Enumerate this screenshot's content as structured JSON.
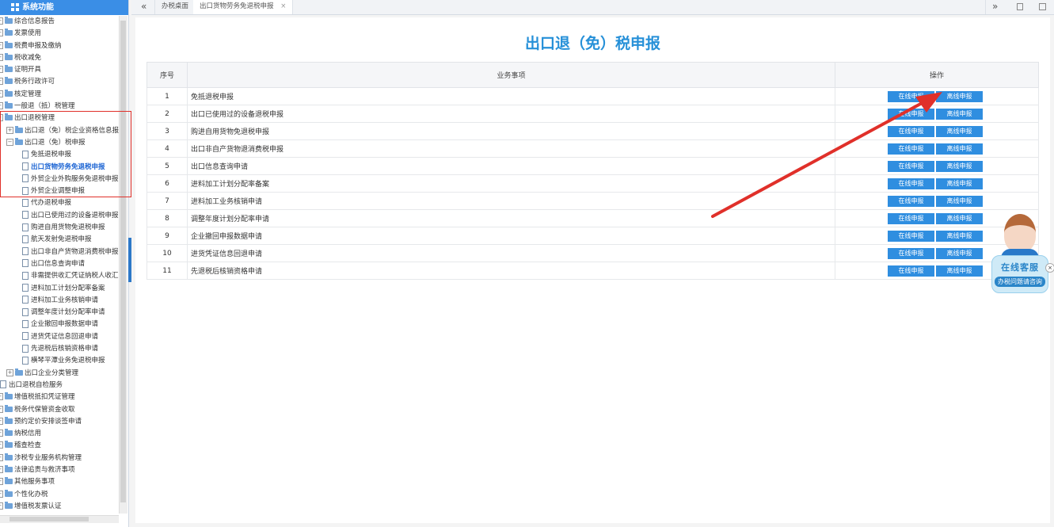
{
  "sidebar": {
    "header": "系统功能",
    "items": [
      {
        "label": "综合信息报告",
        "level": 0,
        "type": "folder",
        "toggle": "-"
      },
      {
        "label": "发票使用",
        "level": 0,
        "type": "folder",
        "toggle": "-"
      },
      {
        "label": "税费申报及缴纳",
        "level": 0,
        "type": "folder",
        "toggle": "-"
      },
      {
        "label": "税收减免",
        "level": 0,
        "type": "folder",
        "toggle": "-"
      },
      {
        "label": "证明开具",
        "level": 0,
        "type": "folder",
        "toggle": "-"
      },
      {
        "label": "税务行政许可",
        "level": 0,
        "type": "folder",
        "toggle": "-"
      },
      {
        "label": "核定管理",
        "level": 0,
        "type": "folder",
        "toggle": "-"
      },
      {
        "label": "一般退（抵）税管理",
        "level": 0,
        "type": "folder",
        "toggle": "-"
      },
      {
        "label": "出口退税管理",
        "level": 0,
        "type": "folder",
        "toggle": "-"
      },
      {
        "label": "出口退（免）税企业资格信息报",
        "level": 1,
        "type": "folder",
        "toggle": "+"
      },
      {
        "label": "出口退（免）税申报",
        "level": 1,
        "type": "folder",
        "toggle": "-"
      },
      {
        "label": "免抵退税申报",
        "level": 2,
        "type": "file"
      },
      {
        "label": "出口货物劳务免退税申报",
        "level": 2,
        "type": "file",
        "selected": true
      },
      {
        "label": "外贸企业外购服务免退税申报",
        "level": 2,
        "type": "file"
      },
      {
        "label": "外贸企业调整申报",
        "level": 2,
        "type": "file"
      },
      {
        "label": "代办退税申报",
        "level": 2,
        "type": "file"
      },
      {
        "label": "出口已使用过的设备退税申报",
        "level": 2,
        "type": "file"
      },
      {
        "label": "购进自用货物免退税申报",
        "level": 2,
        "type": "file"
      },
      {
        "label": "航天发射免退税申报",
        "level": 2,
        "type": "file"
      },
      {
        "label": "出口非自产货物退消费税申报",
        "level": 2,
        "type": "file"
      },
      {
        "label": "出口信息查询申请",
        "level": 2,
        "type": "file"
      },
      {
        "label": "非需提供收汇凭证纳税人收汇",
        "level": 2,
        "type": "file"
      },
      {
        "label": "进料加工计划分配率备案",
        "level": 2,
        "type": "file"
      },
      {
        "label": "进料加工业务核销申请",
        "level": 2,
        "type": "file"
      },
      {
        "label": "调整年度计划分配率申请",
        "level": 2,
        "type": "file"
      },
      {
        "label": "企业撤回申报数据申请",
        "level": 2,
        "type": "file"
      },
      {
        "label": "进货凭证信息回退申请",
        "level": 2,
        "type": "file"
      },
      {
        "label": "先退税后核销资格申请",
        "level": 2,
        "type": "file"
      },
      {
        "label": "横琴平潭业务免退税申报",
        "level": 2,
        "type": "file"
      },
      {
        "label": "出口企业分类管理",
        "level": 1,
        "type": "folder",
        "toggle": "+"
      },
      {
        "label": "出口退税自检服务",
        "level": 0,
        "type": "file"
      },
      {
        "label": "增值税抵扣凭证管理",
        "level": 0,
        "type": "folder",
        "toggle": "-"
      },
      {
        "label": "税务代保管资金收取",
        "level": 0,
        "type": "folder",
        "toggle": "-"
      },
      {
        "label": "预约定价安排谈签申请",
        "level": 0,
        "type": "folder",
        "toggle": "-"
      },
      {
        "label": "纳税信用",
        "level": 0,
        "type": "folder",
        "toggle": "-"
      },
      {
        "label": "稽查检查",
        "level": 0,
        "type": "folder",
        "toggle": "-"
      },
      {
        "label": "涉税专业服务机构管理",
        "level": 0,
        "type": "folder",
        "toggle": "-"
      },
      {
        "label": "法律追责与救济事项",
        "level": 0,
        "type": "folder",
        "toggle": "-"
      },
      {
        "label": "其他服务事项",
        "level": 0,
        "type": "folder",
        "toggle": "-"
      },
      {
        "label": "个性化办税",
        "level": 0,
        "type": "folder",
        "toggle": "-"
      },
      {
        "label": "增值税发票认证",
        "level": 0,
        "type": "folder",
        "toggle": "-"
      }
    ]
  },
  "tabs": {
    "prev_icon": "«",
    "next_icon": "»",
    "home": "办税桌面",
    "active": "出口货物劳务免退税申报",
    "close": "×"
  },
  "main": {
    "title": "出口退（免）税申报",
    "headers": {
      "seq": "序号",
      "item": "业务事项",
      "ops": "操作"
    },
    "online_btn": "在线申报",
    "offline_btn": "离线申报",
    "rows": [
      {
        "seq": "1",
        "item": "免抵退税申报"
      },
      {
        "seq": "2",
        "item": "出口已使用过的设备退税申报"
      },
      {
        "seq": "3",
        "item": "购进自用货物免退税申报"
      },
      {
        "seq": "4",
        "item": "出口非自产货物退消费税申报"
      },
      {
        "seq": "5",
        "item": "出口信息查询申请"
      },
      {
        "seq": "6",
        "item": "进料加工计划分配率备案"
      },
      {
        "seq": "7",
        "item": "进料加工业务核销申请"
      },
      {
        "seq": "8",
        "item": "调整年度计划分配率申请"
      },
      {
        "seq": "9",
        "item": "企业撤回申报数据申请"
      },
      {
        "seq": "10",
        "item": "进货凭证信息回退申请"
      },
      {
        "seq": "11",
        "item": "先退税后核销资格申请"
      }
    ]
  },
  "cs_widget": {
    "title": "在线客服",
    "subtitle": "办税问题请咨询",
    "close": "×"
  },
  "colors": {
    "accent": "#2f8ee0",
    "title": "#2690d8",
    "annotation": "#e0302a"
  }
}
